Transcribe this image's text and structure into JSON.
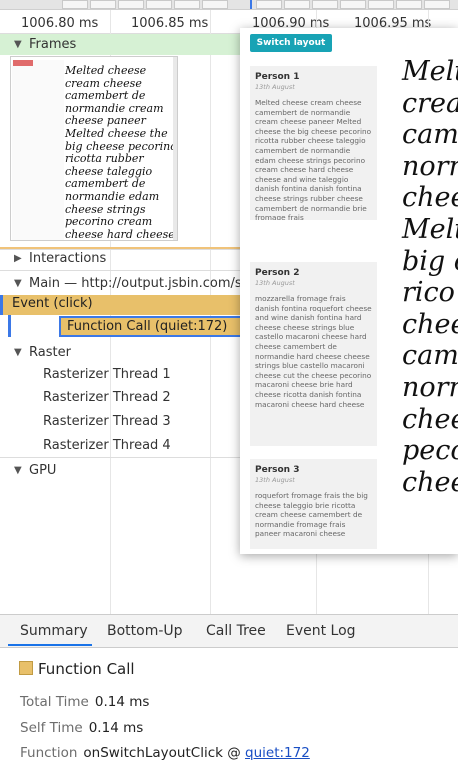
{
  "ruler": {
    "ticks": [
      "1006.80 ms",
      "1006.85 ms",
      "1006.90 ms",
      "1006.95 ms"
    ]
  },
  "tracks": {
    "frames_label": "Frames",
    "interactions_label": "Interactions",
    "main_label": "Main — http://output.jsbin.com/sa",
    "event_label": "Event (click)",
    "function_call_label": "Function Call (quiet:172)",
    "raster_label": "Raster",
    "raster_threads": [
      "Rasterizer Thread 1",
      "Rasterizer Thread 2",
      "Rasterizer Thread 3",
      "Rasterizer Thread 4"
    ],
    "gpu_label": "GPU"
  },
  "frame_preview": {
    "serif_lines": [
      "Melted cheese",
      "cream cheese",
      "camembert de",
      "normandie cream",
      "cheese paneer",
      "Melted cheese the",
      "big cheese pecorino",
      "ricotta rubber",
      "cheese taleggio",
      "camembert de",
      "normandie edam",
      "cheese strings",
      "pecorino cream",
      "cheese hard cheese"
    ]
  },
  "popup": {
    "button_label": "Switch layout",
    "cards": [
      {
        "name": "Person 1",
        "date": "13th August",
        "text": "Melted cheese cream cheese camembert de normandie cream cheese paneer Melted cheese the big cheese pecorino ricotta rubber cheese taleggio camembert de normandie edam cheese strings pecorino cream cheese hard cheese cheese and wine taleggio danish fontina danish fontina cheese strings rubber cheese camembert de normandie brie fromage frais"
      },
      {
        "name": "Person 2",
        "date": "13th August",
        "text": "mozzarella fromage frais danish fontina roquefort cheese and wine danish fontina hard cheese cheese strings blue castello macaroni cheese hard cheese camembert de normandie hard cheese cheese strings blue castello macaroni cheese cut the cheese pecorino macaroni cheese brie hard cheese ricotta danish fontina macaroni cheese hard cheese"
      },
      {
        "name": "Person 3",
        "date": "13th August",
        "text": "roquefort fromage frais the big cheese taleggio brie ricotta cream cheese camembert de normandie fromage frais paneer macaroni cheese"
      }
    ],
    "serif_lines": [
      "Melt",
      "crea",
      "cam",
      "norr",
      "chee",
      "Melt",
      "big c",
      "rico",
      "chee",
      "cam",
      "norr",
      "chee",
      "peco",
      "chee"
    ]
  },
  "tabs": [
    "Summary",
    "Bottom-Up",
    "Call Tree",
    "Event Log"
  ],
  "summary": {
    "title": "Function Call",
    "swatch_color": "#e8c06a",
    "total_time_label": "Total Time",
    "total_time_value": "0.14 ms",
    "self_time_label": "Self Time",
    "self_time_value": "0.14 ms",
    "function_label": "Function",
    "function_name": "onSwitchLayoutClick @",
    "function_link": "quiet:172"
  }
}
